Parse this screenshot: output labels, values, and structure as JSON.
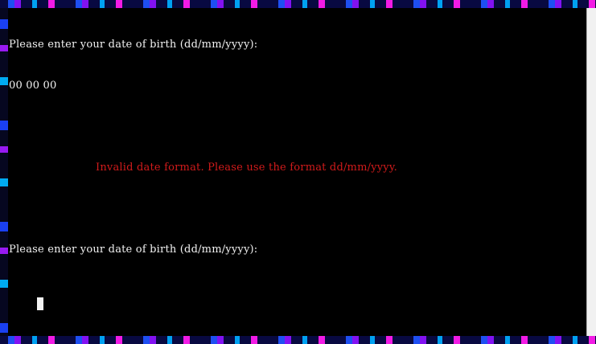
{
  "terminal": {
    "lines": [
      "Please enter your date of birth (dd/mm/yyyy):",
      "00 00 00",
      "",
      "Invalid date format. Please use the format dd/mm/yyyy.",
      "",
      "Please enter your date of birth (dd/mm/yyyy):"
    ]
  },
  "colors": {
    "terminal_text": "#f2f2f2",
    "error_text": "#d21b1b",
    "background": "#000000"
  }
}
